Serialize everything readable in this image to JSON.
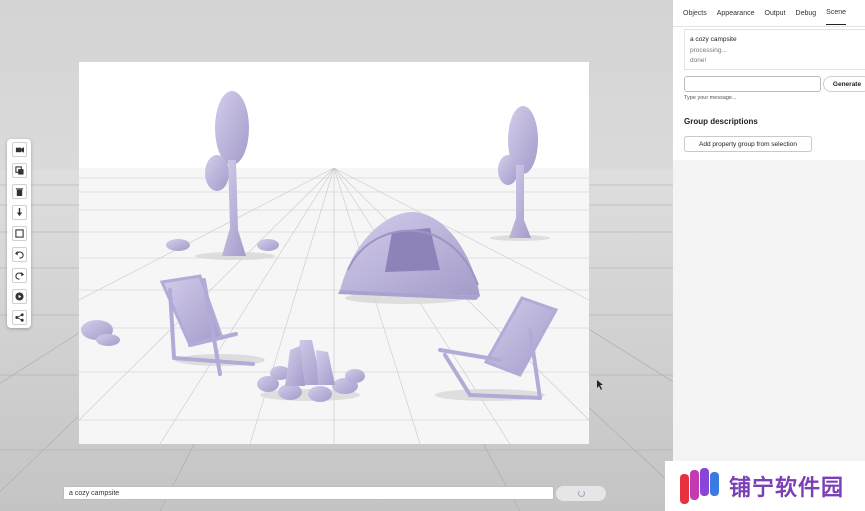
{
  "toolbar": {
    "tools": [
      {
        "name": "camera-tool-button",
        "icon": "camera-icon"
      },
      {
        "name": "duplicate-tool-button",
        "icon": "copy-icon"
      },
      {
        "name": "delete-tool-button",
        "icon": "trash-icon"
      },
      {
        "name": "download-tool-button",
        "icon": "download-icon"
      },
      {
        "name": "frame-tool-button",
        "icon": "square-icon"
      },
      {
        "name": "undo-tool-button",
        "icon": "undo-icon"
      },
      {
        "name": "redo-tool-button",
        "icon": "redo-icon"
      },
      {
        "name": "play-tool-button",
        "icon": "play-icon"
      },
      {
        "name": "share-tool-button",
        "icon": "share-icon"
      }
    ]
  },
  "prompt": {
    "value": "a cozy campsite"
  },
  "panel": {
    "tabs": [
      "Objects",
      "Appearance",
      "Output",
      "Debug",
      "Scene"
    ],
    "active_tab": "Scene",
    "log": {
      "title": "a cozy campsite",
      "line1": "processing...",
      "line2": "done!"
    },
    "input": {
      "placeholder": ""
    },
    "generate_label": "Generate",
    "hint": "Type your message...",
    "group_title": "Group descriptions",
    "add_group_label": "Add property group from selection"
  },
  "watermark": {
    "text": "铺宁软件园"
  },
  "colors": {
    "object": "#c4bde0",
    "object_dark": "#9d94c4",
    "accent": "#7b3fb6"
  }
}
